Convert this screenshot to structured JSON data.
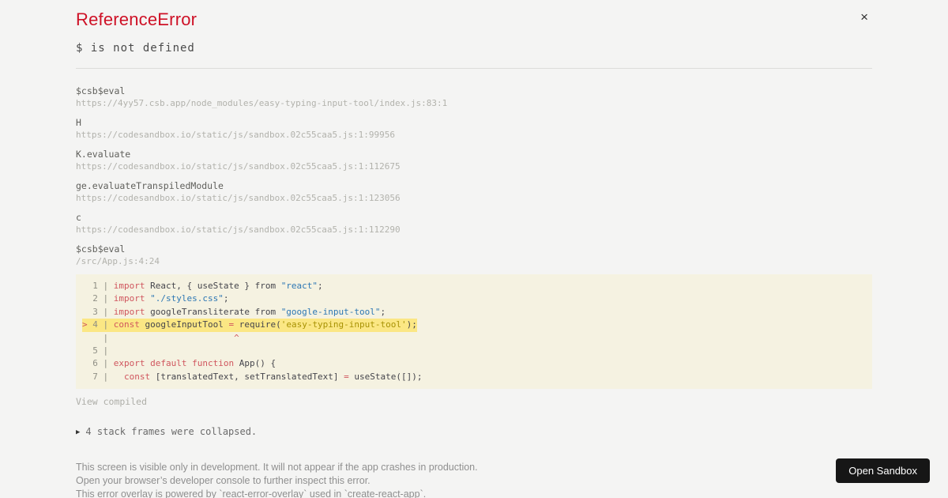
{
  "overlay": {
    "title": "ReferenceError",
    "message": "$ is not defined",
    "close_glyph": "×"
  },
  "stack_frames": [
    {
      "fn": "$csb$eval",
      "loc": "https://4yy57.csb.app/node_modules/easy-typing-input-tool/index.js:83:1"
    },
    {
      "fn": "H",
      "loc": "https://codesandbox.io/static/js/sandbox.02c55caa5.js:1:99956"
    },
    {
      "fn": "K.evaluate",
      "loc": "https://codesandbox.io/static/js/sandbox.02c55caa5.js:1:112675"
    },
    {
      "fn": "ge.evaluateTranspiledModule",
      "loc": "https://codesandbox.io/static/js/sandbox.02c55caa5.js:1:123056"
    },
    {
      "fn": "c",
      "loc": "https://codesandbox.io/static/js/sandbox.02c55caa5.js:1:112290"
    },
    {
      "fn": "$csb$eval",
      "loc": "/src/App.js:4:24"
    }
  ],
  "code_frame": {
    "lines": [
      {
        "highlight": false,
        "tokens": [
          {
            "c": "gutter",
            "t": "  1 | "
          },
          {
            "c": "kw",
            "t": "import"
          },
          {
            "c": "plain",
            "t": " React, { useState } from "
          },
          {
            "c": "str",
            "t": "\"react\""
          },
          {
            "c": "plain",
            "t": ";"
          }
        ]
      },
      {
        "highlight": false,
        "tokens": [
          {
            "c": "gutter",
            "t": "  2 | "
          },
          {
            "c": "kw",
            "t": "import"
          },
          {
            "c": "plain",
            "t": " "
          },
          {
            "c": "str",
            "t": "\"./styles.css\""
          },
          {
            "c": "plain",
            "t": ";"
          }
        ]
      },
      {
        "highlight": false,
        "tokens": [
          {
            "c": "gutter",
            "t": "  3 | "
          },
          {
            "c": "kw",
            "t": "import"
          },
          {
            "c": "plain",
            "t": " googleTransliterate from "
          },
          {
            "c": "str",
            "t": "\"google-input-tool\""
          },
          {
            "c": "plain",
            "t": ";"
          }
        ]
      },
      {
        "highlight": true,
        "tokens": [
          {
            "c": "mark",
            "t": ">"
          },
          {
            "c": "gutter",
            "t": " 4 | "
          },
          {
            "c": "kw",
            "t": "const"
          },
          {
            "c": "plain",
            "t": " googleInputTool "
          },
          {
            "c": "kw",
            "t": "="
          },
          {
            "c": "plain",
            "t": " require("
          },
          {
            "c": "str2",
            "t": "'easy-typing-input-tool'"
          },
          {
            "c": "plain",
            "t": ");"
          }
        ]
      },
      {
        "highlight": false,
        "tokens": [
          {
            "c": "gutter",
            "t": "    | "
          },
          {
            "c": "plain",
            "t": "                       "
          },
          {
            "c": "mark",
            "t": "^"
          }
        ]
      },
      {
        "highlight": false,
        "tokens": [
          {
            "c": "gutter",
            "t": "  5 | "
          }
        ]
      },
      {
        "highlight": false,
        "tokens": [
          {
            "c": "gutter",
            "t": "  6 | "
          },
          {
            "c": "kw",
            "t": "export"
          },
          {
            "c": "plain",
            "t": " "
          },
          {
            "c": "kw",
            "t": "default"
          },
          {
            "c": "plain",
            "t": " "
          },
          {
            "c": "kw",
            "t": "function"
          },
          {
            "c": "plain",
            "t": " App() {"
          }
        ]
      },
      {
        "highlight": false,
        "tokens": [
          {
            "c": "gutter",
            "t": "  7 | "
          },
          {
            "c": "plain",
            "t": "  "
          },
          {
            "c": "kw",
            "t": "const"
          },
          {
            "c": "plain",
            "t": " [translatedText, setTranslatedText] "
          },
          {
            "c": "kw",
            "t": "="
          },
          {
            "c": "plain",
            "t": " useState([]);"
          }
        ]
      }
    ]
  },
  "view_compiled_label": "View compiled",
  "collapsed": {
    "marker": "▶",
    "label": "4 stack frames were collapsed."
  },
  "footer": {
    "lines": [
      "This screen is visible only in development. It will not appear if the app crashes in production.",
      "Open your browser’s developer console to further inspect this error.",
      "This error overlay is powered by `react-error-overlay` used in `create-react-app`."
    ]
  },
  "open_sandbox_label": "Open Sandbox",
  "colors": {
    "page_bg": "#f4f4f3",
    "title_red": "#ce1126",
    "keyword": "#d0565e",
    "string_blue": "#2d77b4",
    "string_olive": "#a89204",
    "code_bg": "#f5f2e1",
    "highlight_bg": "#fbe784",
    "button_bg": "#161616"
  }
}
